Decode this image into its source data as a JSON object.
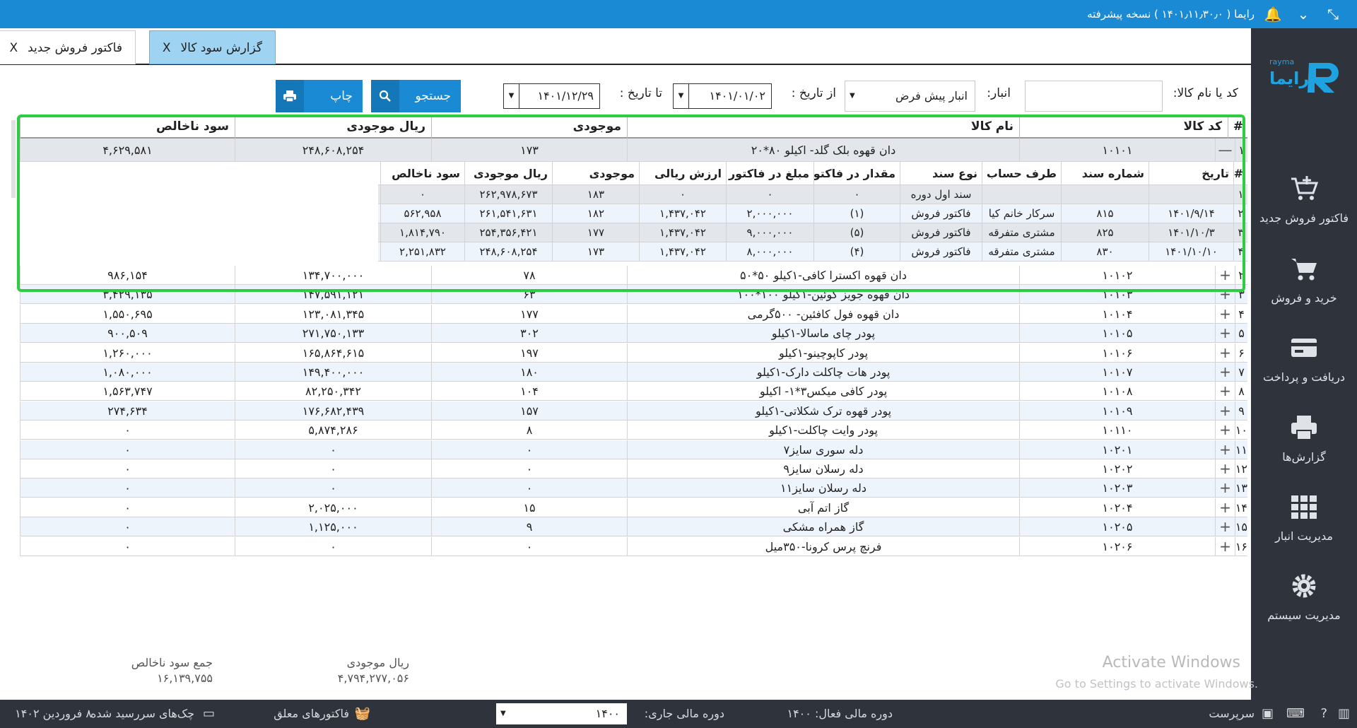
{
  "app": {
    "title": "رایما ( ۱۴۰۱٫۱۱٫۳۰٫۰ ) نسخه پیشرفته",
    "logo_text": "رایما",
    "logo_sub": "rayma"
  },
  "tabs": [
    {
      "label": "گزارش سود کالا",
      "close": "X"
    },
    {
      "label": "فاکتور فروش جدید",
      "close": "X"
    }
  ],
  "sidebar": [
    {
      "label": "فاکتور فروش جدید",
      "icon": "cart-plus-icon"
    },
    {
      "label": "خرید و فروش",
      "icon": "cart-icon"
    },
    {
      "label": "دریافت و پرداخت",
      "icon": "credit-card-icon"
    },
    {
      "label": "گزارش‌ها",
      "icon": "printer-icon"
    },
    {
      "label": "مدیریت انبار",
      "icon": "grid-icon"
    },
    {
      "label": "مدیریت سیستم",
      "icon": "gear-icon"
    }
  ],
  "filters": {
    "code_label": "کد یا نام کالا:",
    "code_value": "",
    "warehouse_label": "انبار:",
    "warehouse_value": "انبار پیش فرض",
    "from_label": "از تاریخ :",
    "from_value": "۱۴۰۱/۰۱/۰۲",
    "to_label": "تا تاریخ :",
    "to_value": "۱۴۰۱/۱۲/۲۹",
    "search_label": "جستجو",
    "print_label": "چاپ"
  },
  "grid": {
    "headers": [
      "#",
      "کد کالا",
      "نام کالا",
      "موجودی",
      "ریال موجودی",
      "سود ناخالص"
    ],
    "expanded": {
      "no": "۱",
      "code": "۱۰۱۰۱",
      "name": "دان قهوه بلک گلد- اکیلو ۸۰*۲۰",
      "stock": "۱۷۳",
      "value": "۲۴۸,۶۰۸,۲۵۴",
      "profit": "۴,۶۲۹,۵۸۱",
      "toggle": "—"
    },
    "sub_headers": [
      "#",
      "تاریخ",
      "شماره سند",
      "طرف حساب",
      "نوع سند",
      "مقدار در فاکتور",
      "مبلغ در فاکتور",
      "ارزش ریالی",
      "موجودی",
      "ریال موجودی",
      "سود ناخالص"
    ],
    "sub_rows": [
      [
        "۱",
        "",
        "",
        "",
        "سند اول دوره",
        "۰",
        "۰",
        "۰",
        "۱۸۳",
        "۲۶۲,۹۷۸,۶۷۳",
        "۰"
      ],
      [
        "۲",
        "۱۴۰۱/۹/۱۴",
        "۸۱۵",
        "سرکار خانم  کیا",
        "فاکتور فروش",
        "(۱)",
        "۲,۰۰۰,۰۰۰",
        "۱,۴۳۷,۰۴۲",
        "۱۸۲",
        "۲۶۱,۵۴۱,۶۳۱",
        "۵۶۲,۹۵۸"
      ],
      [
        "۳",
        "۱۴۰۱/۱۰/۳",
        "۸۲۵",
        "مشتری متفرقه",
        "فاکتور فروش",
        "(۵)",
        "۹,۰۰۰,۰۰۰",
        "۱,۴۳۷,۰۴۲",
        "۱۷۷",
        "۲۵۴,۳۵۶,۴۲۱",
        "۱,۸۱۴,۷۹۰"
      ],
      [
        "۴",
        "۱۴۰۱/۱۰/۱۰",
        "۸۳۰",
        "مشتری متفرقه",
        "فاکتور فروش",
        "(۴)",
        "۸,۰۰۰,۰۰۰",
        "۱,۴۳۷,۰۴۲",
        "۱۷۳",
        "۲۴۸,۶۰۸,۲۵۴",
        "۲,۲۵۱,۸۳۲"
      ]
    ],
    "rows": [
      [
        "۲",
        "۱۰۱۰۲",
        "دان قهوه اکسترا کافی-۱کیلو ۵۰*۵۰",
        "۷۸",
        "۱۳۴,۷۰۰,۰۰۰",
        "۹۸۶,۱۵۴"
      ],
      [
        "۳",
        "۱۰۱۰۳",
        "دان قهوه جویز کوئین-۱کیلو ۱۰۰*۱۰۰",
        "۶۳",
        "۱۴۷,۵۹۱,۱۲۱",
        "۳,۴۲۹,۱۳۵"
      ],
      [
        "۴",
        "۱۰۱۰۴",
        "دان قهوه فول کافئین- ۵۰۰گرمی",
        "۱۷۷",
        "۱۲۳,۰۸۱,۳۴۵",
        "۱,۵۵۰,۶۹۵"
      ],
      [
        "۵",
        "۱۰۱۰۵",
        "پودر چای ماسالا-۱کیلو",
        "۳۰۲",
        "۲۷۱,۷۵۰,۱۳۳",
        "۹۰۰,۵۰۹"
      ],
      [
        "۶",
        "۱۰۱۰۶",
        "پودر کاپوچینو-۱کیلو",
        "۱۹۷",
        "۱۶۵,۸۶۴,۶۱۵",
        "۱,۲۶۰,۰۰۰"
      ],
      [
        "۷",
        "۱۰۱۰۷",
        "پودر هات چاکلت دارک-۱کیلو",
        "۱۸۰",
        "۱۴۹,۴۰۰,۰۰۰",
        "۱,۰۸۰,۰۰۰"
      ],
      [
        "۸",
        "۱۰۱۰۸",
        "پودر کافی میکس۳*۱- اکیلو",
        "۱۰۴",
        "۸۲,۲۵۰,۳۴۲",
        "۱,۵۶۳,۷۴۷"
      ],
      [
        "۹",
        "۱۰۱۰۹",
        "پودر قهوه ترک شکلاتی-۱کیلو",
        "۱۵۷",
        "۱۷۶,۶۸۲,۴۳۹",
        "۲۷۴,۶۳۴"
      ],
      [
        "۱۰",
        "۱۰۱۱۰",
        "پودر وایت چاکلت-۱کیلو",
        "۸",
        "۵,۸۷۴,۲۸۶",
        "۰"
      ],
      [
        "۱۱",
        "۱۰۲۰۱",
        "دله سوری سایز۷",
        "۰",
        "۰",
        "۰"
      ],
      [
        "۱۲",
        "۱۰۲۰۲",
        "دله رسلان سایز۹",
        "۰",
        "۰",
        "۰"
      ],
      [
        "۱۳",
        "۱۰۲۰۳",
        "دله رسلان سایز۱۱",
        "۰",
        "۰",
        "۰"
      ],
      [
        "۱۴",
        "۱۰۲۰۴",
        "گاز اتم آبی",
        "۱۵",
        "۲,۰۲۵,۰۰۰",
        "۰"
      ],
      [
        "۱۵",
        "۱۰۲۰۵",
        "گاز همراه مشکی",
        "۹",
        "۱,۱۲۵,۰۰۰",
        "۰"
      ],
      [
        "۱۶",
        "۱۰۲۰۶",
        "فرنچ پرس کرونا-۳۵۰میل",
        "۰",
        "۰",
        "۰"
      ]
    ],
    "expand_symbol": "+"
  },
  "totals": {
    "value_label": "ریال موجودی",
    "value": "۴,۷۹۴,۲۷۷,۰۵۶",
    "profit_label": "جمع سود ناخالص",
    "profit": "۱۶,۱۳۹,۷۵۵"
  },
  "watermark": {
    "line1": "Activate Windows",
    "line2": "Go to Settings to activate Windows."
  },
  "status": {
    "user": "سرپرست",
    "active_year": "دوره مالی فعال: ۱۴۰۰",
    "current_year_label": "دوره مالی جاری:",
    "current_year_value": "۱۴۰۰",
    "pending_invoices": "فاکتورهای معلق",
    "due_checks": "چک‌های سررسید شده",
    "date": "۸ فروردین ۱۴۰۲"
  },
  "colors": {
    "topbar": "#1a8ad4",
    "sidebar": "#2f343c",
    "highlight": "#2ecc40",
    "active_tab": "#9fd3f2"
  }
}
